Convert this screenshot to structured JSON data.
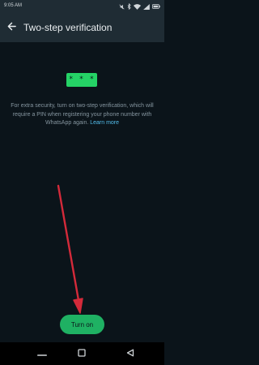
{
  "status_bar": {
    "time": "9:05 AM",
    "icons": [
      "silent-icon",
      "bluetooth-icon",
      "wifi-icon",
      "signal-icon",
      "battery-icon"
    ]
  },
  "app_bar": {
    "title": "Two-step verification",
    "back_icon": "back-arrow-icon"
  },
  "illustration": {
    "text": "* * *",
    "color": "#25d366"
  },
  "description": {
    "text": "For extra security, turn on two-step verification, which will require a PIN when registering your phone number with WhatsApp again. ",
    "link_text": "Learn more"
  },
  "turn_on_button": {
    "label": "Turn on"
  },
  "nav_bar": {
    "items": [
      "recents-icon",
      "home-icon",
      "back-icon"
    ]
  },
  "colors": {
    "background": "#0b141a",
    "bar": "#1f2c34",
    "accent": "#1fb163",
    "link": "#53bdeb",
    "annotation_arrow": "#d42a3a"
  }
}
